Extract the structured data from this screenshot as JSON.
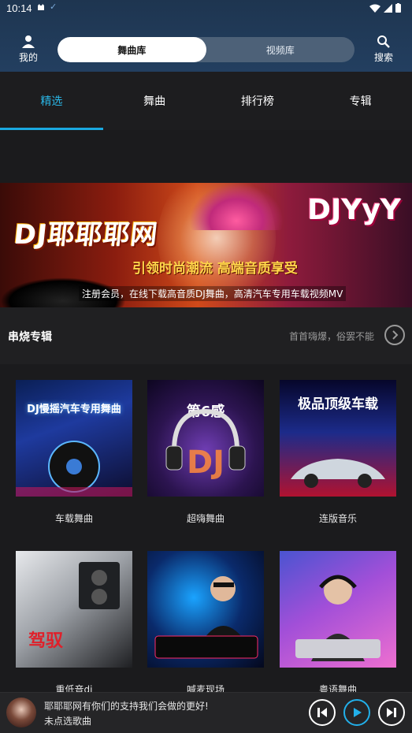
{
  "status": {
    "time": "10:14",
    "check": "✓"
  },
  "header": {
    "mine_label": "我的",
    "search_label": "搜索",
    "segments": [
      "舞曲库",
      "视频库"
    ]
  },
  "tabs": [
    "精选",
    "舞曲",
    "排行榜",
    "专辑"
  ],
  "banner": {
    "brand": "DJ耶耶耶网",
    "brand2": "DJYyY",
    "slogan": "引领时尚潮流 高端音质享受",
    "sub": "注册会员，在线下载高音质DJ舞曲，高清汽车专用车载视频MV"
  },
  "section": {
    "title": "串烧专辑",
    "desc": "首首嗨爆，俗罢不能"
  },
  "albums": [
    {
      "name": "车载舞曲",
      "cover_text": "DJ慢摇汽车专用舞曲"
    },
    {
      "name": "超嗨舞曲",
      "cover_text": "第6感"
    },
    {
      "name": "连版音乐",
      "cover_text": "极品顶级车载"
    },
    {
      "name": "重低音dj",
      "cover_text": "驾驭"
    },
    {
      "name": "喊麦现场",
      "cover_text": ""
    },
    {
      "name": "粤语舞曲",
      "cover_text": ""
    }
  ],
  "player": {
    "line1": "耶耶耶网有你们的支持我们会做的更好!",
    "line2": "未点选歌曲"
  },
  "colors": {
    "accent": "#1aa9e0",
    "header": "#1e3550"
  }
}
